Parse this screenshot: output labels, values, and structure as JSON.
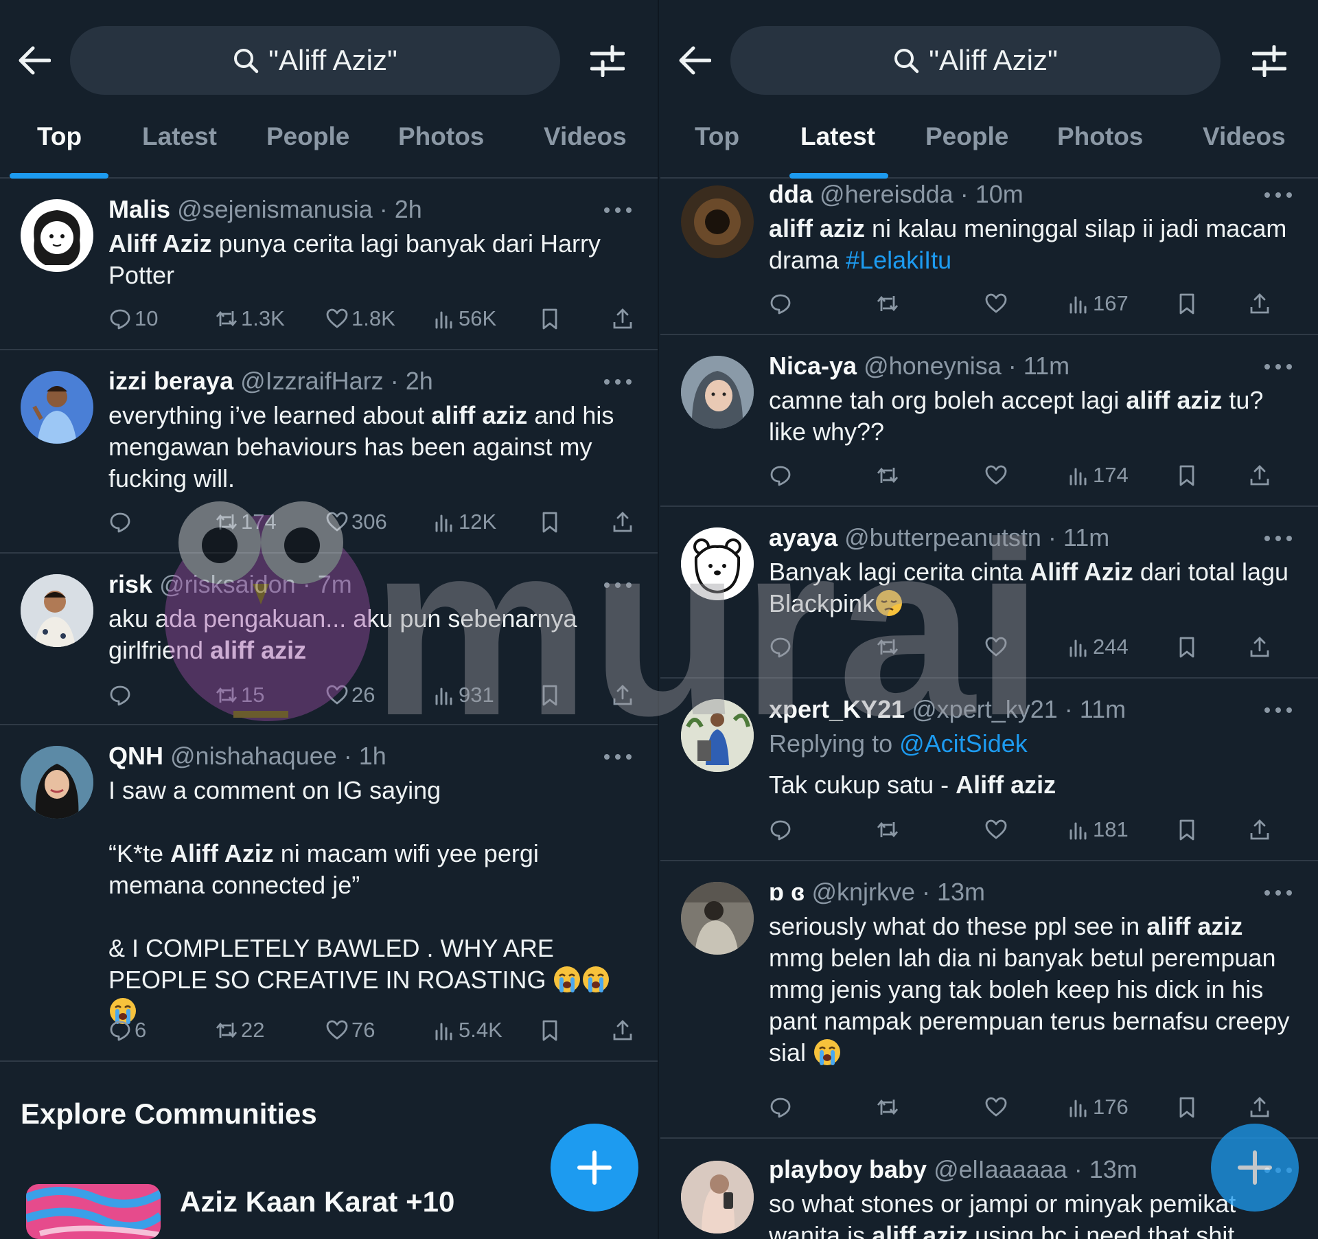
{
  "search": {
    "query": "\"Aliff Aziz\""
  },
  "tabs": [
    "Top",
    "Latest",
    "People",
    "Photos",
    "Videos"
  ],
  "left": {
    "active_tab": "Top",
    "tweets": [
      {
        "name": "Malis",
        "handle": "@sejenismanusia",
        "time": "2h",
        "text_parts": [
          {
            "b": "Aliff Aziz"
          },
          {
            "t": " punya cerita lagi banyak dari Harry Potter"
          }
        ],
        "replies": "10",
        "retweets": "1.3K",
        "likes": "1.8K",
        "views": "56K"
      },
      {
        "name": "izzi beraya",
        "handle": "@IzzraifHarz",
        "time": "2h",
        "text_parts": [
          {
            "t": "everything i’ve learned about "
          },
          {
            "b": "aliff aziz"
          },
          {
            "t": " and his mengawan behaviours has been against my fucking will."
          }
        ],
        "replies": "",
        "retweets": "174",
        "likes": "306",
        "views": "12K"
      },
      {
        "name": "risk",
        "handle": "@risksaidon",
        "time": "7m",
        "text_parts": [
          {
            "t": "aku ada pengakuan... aku pun sebenarnya girlfriend "
          },
          {
            "b": "aliff aziz"
          }
        ],
        "replies": "",
        "retweets": "15",
        "likes": "26",
        "views": "931"
      },
      {
        "name": "QNH",
        "handle": "@nishahaquee",
        "time": "1h",
        "text_parts": [
          {
            "t": "I saw a comment on IG saying"
          },
          {
            "br": true
          },
          {
            "br": true
          },
          {
            "t": "“K*te "
          },
          {
            "b": "Aliff Aziz"
          },
          {
            "t": " ni macam wifi yee pergi memana connected je”"
          },
          {
            "br": true
          },
          {
            "br": true
          },
          {
            "t": "& I COMPLETELY BAWLED . WHY ARE PEOPLE SO CREATIVE IN ROASTING "
          },
          {
            "emoji": "crying"
          },
          {
            "emoji": "crying"
          },
          {
            "emoji": "crying"
          }
        ],
        "replies": "6",
        "retweets": "22",
        "likes": "76",
        "views": "5.4K"
      }
    ],
    "explore_title": "Explore Communities",
    "community_name": "Aziz Kaan Karat +10"
  },
  "right": {
    "active_tab": "Latest",
    "tweets": [
      {
        "name": "dda",
        "handle": "@hereisdda",
        "time": "10m",
        "text_parts": [
          {
            "b": "aliff aziz"
          },
          {
            "t": " ni kalau meninggal silap ii jadi macam drama "
          },
          {
            "link": "#LelakiItu"
          }
        ],
        "views": "167"
      },
      {
        "name": "Nica-ya",
        "handle": "@honeynisa",
        "time": "11m",
        "text_parts": [
          {
            "t": "camne tah org boleh accept lagi "
          },
          {
            "b": "aliff aziz"
          },
          {
            "t": " tu? like why??"
          }
        ],
        "views": "174"
      },
      {
        "name": "ayaya",
        "handle": "@butterpeanutstn",
        "time": "11m",
        "text_parts": [
          {
            "t": "Banyak lagi cerita cinta "
          },
          {
            "b": "Aliff Aziz"
          },
          {
            "t": " dari total lagu Blackpink"
          },
          {
            "emoji": "pensive"
          }
        ],
        "views": "244"
      },
      {
        "name": "xpert_KY21",
        "handle": "@xpert_ky21",
        "time": "11m",
        "replying_to_label": "Replying to",
        "replying_to": "@AcitSidek",
        "text_parts": [
          {
            "t": "Tak cukup satu - "
          },
          {
            "b": "Aliff aziz"
          }
        ],
        "views": "181"
      },
      {
        "name": "ɒ ɞ",
        "handle": "@knjrkve",
        "time": "13m",
        "text_parts": [
          {
            "t": "seriously what do these ppl see in "
          },
          {
            "b": "aliff aziz"
          },
          {
            "t": " mmg belen lah dia ni banyak betul perempuan mmg jenis yang tak boleh keep his dick in his pant nampak perempuan terus bernafsu creepy sial "
          },
          {
            "emoji": "crying"
          }
        ],
        "views": "176"
      },
      {
        "name": "playboy baby",
        "handle": "@elIaaaaaa",
        "time": "13m",
        "text_parts": [
          {
            "t": "so what stones or jampi or minyak pemikat wanita is "
          },
          {
            "b": "aliff aziz"
          },
          {
            "t": " using bc i need that shit"
          }
        ],
        "views": ""
      }
    ]
  },
  "watermark": {
    "text": "murai"
  },
  "colors": {
    "background": "#15202b",
    "accent": "#1d9bf0",
    "muted": "#8b98a5",
    "search_bg": "#273340"
  }
}
